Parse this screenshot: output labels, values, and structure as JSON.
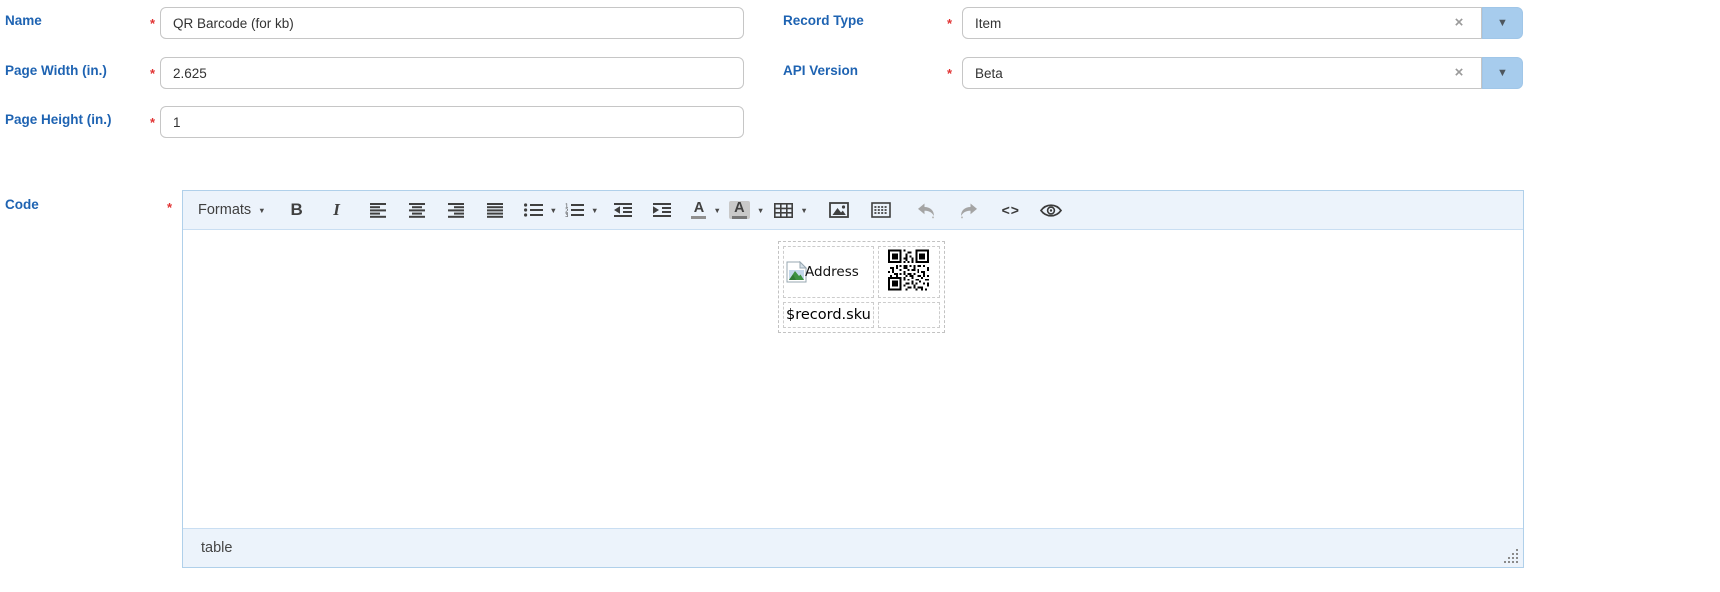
{
  "colors": {
    "label_blue": "#1e63b2",
    "required_red": "#e13232",
    "input_border": "#c6c6c6",
    "combo_button_bg": "#a7cced",
    "editor_border": "#b0d0ea",
    "toolbar_bg": "#ecf3fb",
    "statusbar_bg": "#ecf3fb",
    "icon_color": "#404040",
    "icon_disabled": "#a4a4a4"
  },
  "form": {
    "required_marker": "*",
    "fields": {
      "name": {
        "label": "Name",
        "value": "QR Barcode (for kb)"
      },
      "page_width": {
        "label": "Page Width (in.)",
        "value": "2.625"
      },
      "page_height": {
        "label": "Page Height (in.)",
        "value": "1"
      },
      "record_type": {
        "label": "Record Type",
        "value": "Item"
      },
      "api_version": {
        "label": "API Version",
        "value": "Beta"
      },
      "code": {
        "label": "Code"
      }
    },
    "combo": {
      "clear_glyph": "×",
      "arrow_glyph": "▼"
    }
  },
  "editor": {
    "toolbar": {
      "formats_label": "Formats",
      "caret_glyph": "▼",
      "bold_glyph": "B",
      "italic_glyph": "I",
      "color_glyph": "A",
      "source_code_glyph": "<>",
      "icons": [
        "formats-dropdown",
        "bold",
        "italic",
        "align-left",
        "align-center",
        "align-right",
        "align-justify",
        "bullet-list",
        "numbered-list",
        "outdent",
        "indent",
        "text-color",
        "background-color",
        "table",
        "insert-image",
        "barcode",
        "undo",
        "redo",
        "source-code",
        "preview"
      ]
    },
    "content": {
      "table": {
        "row1_cell1_alt": "Address",
        "row2_cell1_text": "$record.sku"
      }
    },
    "statusbar": {
      "element_path": "table"
    }
  }
}
